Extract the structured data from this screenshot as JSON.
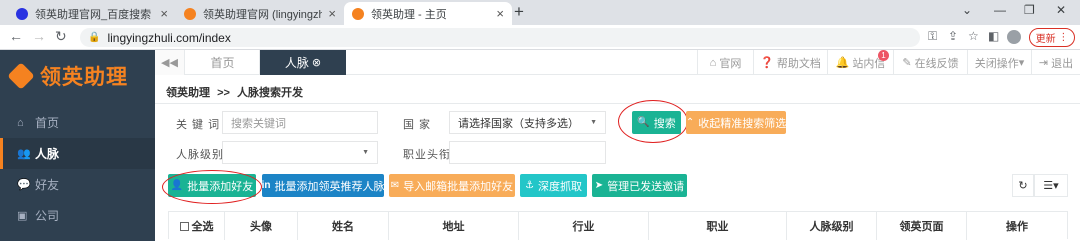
{
  "browser": {
    "tabs": [
      {
        "title": "领英助理官网_百度搜索",
        "icon": "baidu-icon",
        "color": "#2932e1"
      },
      {
        "title": "领英助理官网 (lingyingzhuli.co",
        "icon": "lingying-icon",
        "color": "#f58220"
      },
      {
        "title": "领英助理 - 主页",
        "icon": "lingying-icon",
        "color": "#f58220"
      }
    ],
    "new_tab": "+",
    "url": "lingyingzhuli.com/index",
    "update_label": "更新"
  },
  "app": {
    "logo_text": "领英助理",
    "brand_color": "#f58220",
    "sidebar": [
      {
        "label": "首页",
        "icon": "home-icon"
      },
      {
        "label": "人脉",
        "icon": "users-plus-icon"
      },
      {
        "label": "好友",
        "icon": "chat-icon"
      },
      {
        "label": "公司",
        "icon": "briefcase-icon"
      }
    ],
    "topnav": {
      "home_tab": "首页",
      "active_tab": "人脉",
      "right": [
        {
          "label": "官网",
          "icon": "home-icon"
        },
        {
          "label": "帮助文档",
          "icon": "help-icon"
        },
        {
          "label": "站内信",
          "icon": "bell-icon"
        },
        {
          "label": "在线反馈",
          "icon": "edit-icon"
        },
        {
          "label": "关闭操作",
          "icon": "caret-down-icon"
        },
        {
          "label": "退出",
          "icon": "signout-icon"
        }
      ],
      "notification_count": "1"
    },
    "breadcrumb": {
      "root": "领英助理",
      "sep": ">>",
      "current": "人脉搜索开发"
    },
    "form": {
      "keyword_label": "关 键 词",
      "keyword_placeholder": "搜索关键词",
      "country_label": "国 家",
      "country_value": "请选择国家（支持多选）",
      "level_label": "人脉级别",
      "level_value": "",
      "title_label": "职业头衔",
      "title_value": "",
      "search_button": "搜索",
      "collapse_button": "收起精准搜索筛选"
    },
    "actions": [
      {
        "label": "批量添加好友",
        "icon": "user-plus-icon",
        "color": "#1ab394"
      },
      {
        "label": "批量添加领英推荐人脉",
        "icon": "linkedin-icon",
        "color": "#1c84c6"
      },
      {
        "label": "导入邮箱批量添加好友",
        "icon": "envelope-icon",
        "color": "#f8ac59"
      },
      {
        "label": "深度抓取",
        "icon": "anchor-icon",
        "color": "#23c6c8"
      },
      {
        "label": "管理已发送邀请",
        "icon": "send-icon",
        "color": "#1ab394"
      }
    ],
    "table": {
      "columns": [
        "全选",
        "头像",
        "姓名",
        "地址",
        "行业",
        "职业",
        "人脉级别",
        "领英页面",
        "操作"
      ]
    }
  }
}
